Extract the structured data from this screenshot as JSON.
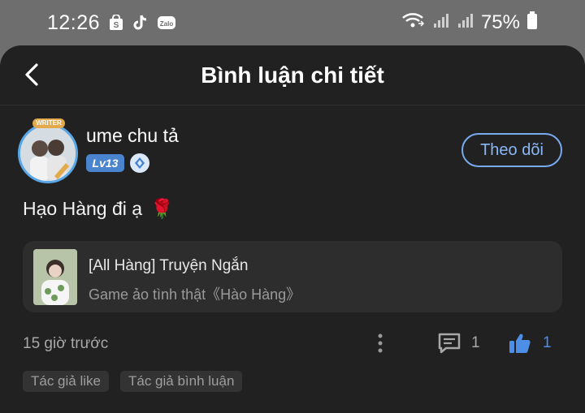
{
  "status_bar": {
    "time": "12:26",
    "battery": "75%",
    "notification_icons": [
      "shop-icon",
      "tiktok-icon",
      "zalo-icon"
    ],
    "zalo_label": "Zalo"
  },
  "header": {
    "title": "Bình luận chi tiết"
  },
  "author": {
    "name": "ume chu tả",
    "level": "Lv13",
    "writer_badge": "WRITER",
    "follow_label": "Theo dõi"
  },
  "comment": {
    "text": "Hạo Hàng đi ạ",
    "emoji": "🌹"
  },
  "story": {
    "title": "[All Hàng] Truyện Ngắn",
    "subtitle": "Game ảo tình thật《Hào Hàng》"
  },
  "meta": {
    "time_ago": "15 giờ trước",
    "comment_count": "1",
    "like_count": "1"
  },
  "tags": [
    "Tác giả like",
    "Tác giả bình luận"
  ],
  "colors": {
    "accent": "#4d8fe6",
    "follow_border": "#78aaf0",
    "sheet_bg": "#212121",
    "card_bg": "#2d2d2d"
  }
}
